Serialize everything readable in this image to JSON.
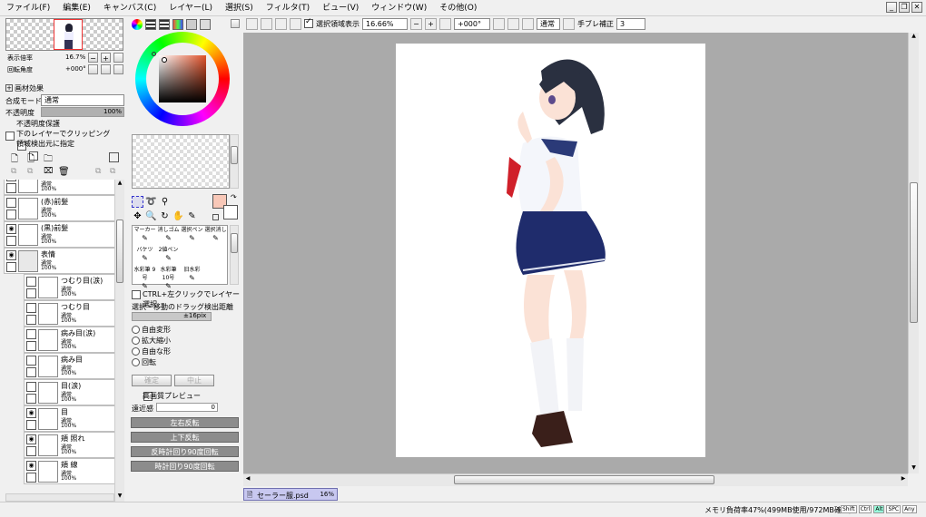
{
  "menu": [
    "ファイル(F)",
    "編集(E)",
    "キャンバス(C)",
    "レイヤー(L)",
    "選択(S)",
    "フィルタ(T)",
    "ビュー(V)",
    "ウィンドウ(W)",
    "その他(O)"
  ],
  "toolbar": {
    "selection_display": "選択領域表示",
    "zoom": "16.66%",
    "rotation": "+000°",
    "blend": "通常",
    "stabilizer_label": "手ブレ補正",
    "stabilizer_value": "3"
  },
  "navigator": {
    "zoom_label": "表示倍率",
    "zoom_value": "16.7%",
    "angle_label": "回転角度",
    "angle_value": "+000°"
  },
  "layer_props": {
    "section": "画材効果",
    "blend_label": "合成モード",
    "blend_value": "通常",
    "opacity_label": "不透明度",
    "opacity_value": "100%",
    "opacity_fraction": 1.0,
    "protect": "不透明度保護",
    "clip": "下のレイヤーでクリッピング",
    "select_source": "領域検出元に指定"
  },
  "layers": [
    {
      "name": "",
      "mode": "通常",
      "opacity": "100%",
      "visible": false,
      "sub": false
    },
    {
      "name": "(赤)前髪",
      "mode": "通常",
      "opacity": "100%",
      "visible": false,
      "sub": false
    },
    {
      "name": "(黒)前髪",
      "mode": "通常",
      "opacity": "100%",
      "visible": true,
      "sub": false
    },
    {
      "name": "表情",
      "mode": "通常",
      "opacity": "100%",
      "visible": true,
      "sub": false,
      "folder": true
    },
    {
      "name": "つむり目(涙)",
      "mode": "通常",
      "opacity": "100%",
      "visible": false,
      "sub": true
    },
    {
      "name": "つむり目",
      "mode": "通常",
      "opacity": "100%",
      "visible": false,
      "sub": true
    },
    {
      "name": "病み目(涙)",
      "mode": "通常",
      "opacity": "100%",
      "visible": false,
      "sub": true
    },
    {
      "name": "病み目",
      "mode": "通常",
      "opacity": "100%",
      "visible": false,
      "sub": true
    },
    {
      "name": "目(涙)",
      "mode": "通常",
      "opacity": "100%",
      "visible": false,
      "sub": true
    },
    {
      "name": "目",
      "mode": "通常",
      "opacity": "100%",
      "visible": true,
      "sub": true
    },
    {
      "name": "頬 照れ",
      "mode": "通常",
      "opacity": "100%",
      "visible": true,
      "sub": true
    },
    {
      "name": "頬 線",
      "mode": "通常",
      "opacity": "100%",
      "visible": true,
      "sub": true
    }
  ],
  "tools": [
    {
      "label": "マーカー",
      "icon": "marker-icon"
    },
    {
      "label": "消しゴム",
      "icon": "eraser-icon"
    },
    {
      "label": "選択ペン",
      "icon": "select-pen-icon"
    },
    {
      "label": "選択消し",
      "icon": "select-erase-icon"
    },
    {
      "label": "バケツ",
      "icon": "bucket-icon"
    },
    {
      "label": "2値ペン",
      "icon": "binary-pen-icon"
    },
    {
      "label": "",
      "icon": ""
    },
    {
      "label": "",
      "icon": ""
    },
    {
      "label": "水彩筆 9号",
      "icon": "watercolor-icon"
    },
    {
      "label": "水彩筆 10号",
      "icon": "watercolor-icon"
    },
    {
      "label": "旧水彩",
      "icon": "old-watercolor-icon"
    },
    {
      "label": "",
      "icon": ""
    }
  ],
  "tool_options": {
    "ctrl_select": "CTRL+左クリックでレイヤー選択",
    "drag_label": "選択・移動のドラッグ検出距離",
    "drag_value": "±16pix",
    "free_transform": "自由変形",
    "scale": "拡大縮小",
    "free_shape": "自由な形",
    "rotate": "回転",
    "ok": "確定",
    "cancel": "中止",
    "hq_preview": "高画質プレビュー",
    "perspective_label": "遠近感",
    "perspective_value": "0",
    "flip_h": "左右反転",
    "flip_v": "上下反転",
    "rot_ccw": "反時計回り90度回転",
    "rot_cw": "時計回り90度回転"
  },
  "document_tab": {
    "name": "セーラー服.psd",
    "zoom": "16%"
  },
  "status": {
    "memory": "メモリ負荷率47%(499MB使用/972MB確保)",
    "keys": [
      "Shift",
      "Ctrl",
      "Alt",
      "SPC",
      "Any"
    ]
  },
  "colors": {
    "current": "#f8c8b8",
    "canvas_bg": "#aaaaaa"
  }
}
